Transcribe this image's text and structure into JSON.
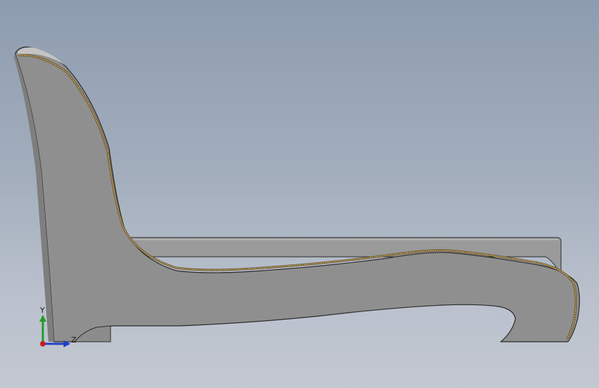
{
  "viewport": {
    "background_top": "#8d9caf",
    "background_bottom": "#c3c8d1"
  },
  "model": {
    "body_color": "#8f8f8f",
    "body_light": "#a6a6a6",
    "edge_color": "#2a2a2a",
    "rivet_color": "#b89a55"
  },
  "triad": {
    "y_label": "Y",
    "z_label": "Z",
    "y_color": "#1f9a2a",
    "z_color": "#1f3fc8",
    "x_color": "#c81f1f"
  }
}
